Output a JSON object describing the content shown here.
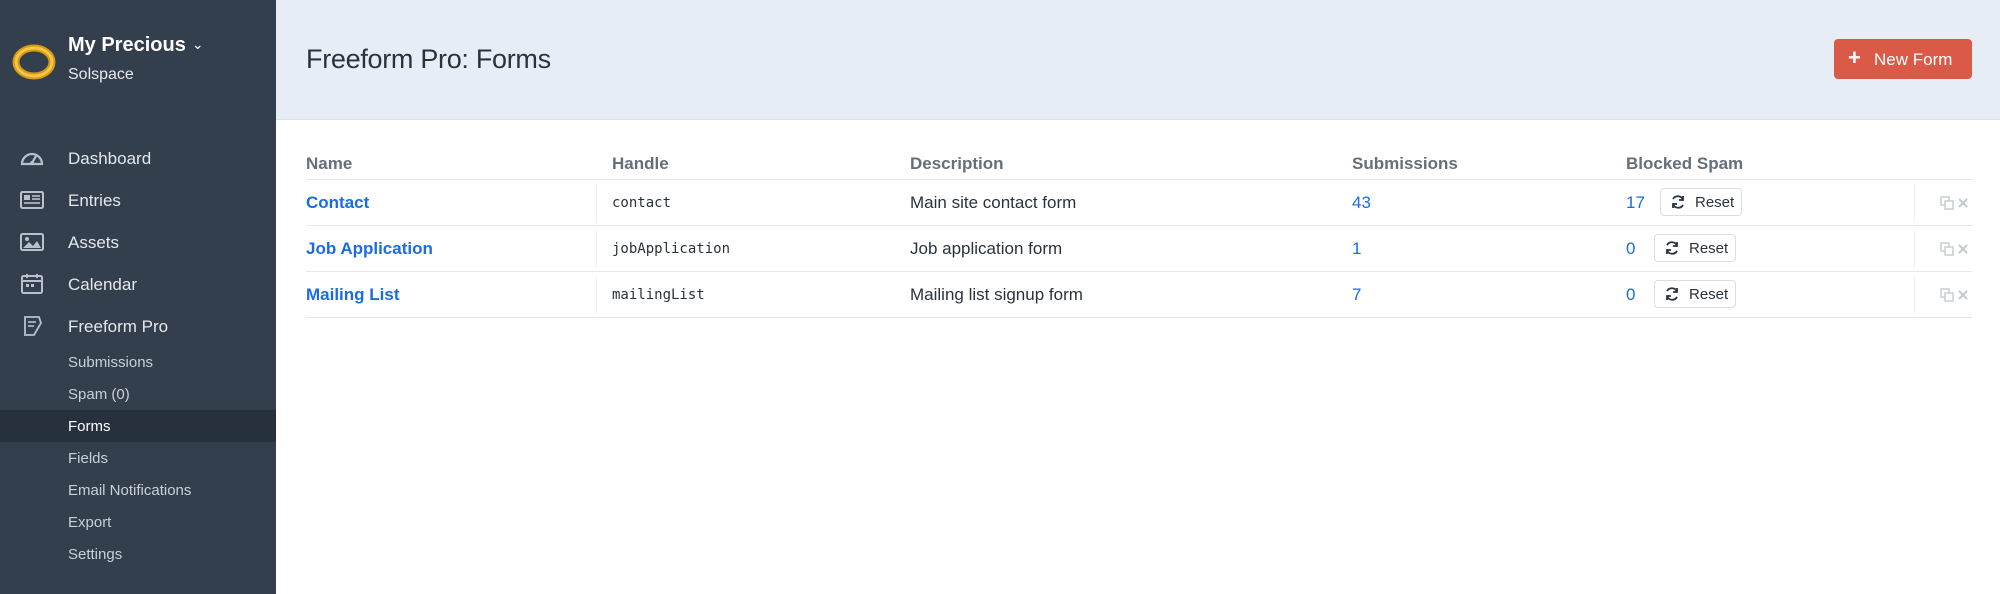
{
  "site": {
    "name": "My Precious",
    "subtitle": "Solspace",
    "chevron": "chevron-down-icon",
    "logo": "ring-logo"
  },
  "nav": [
    {
      "label": "Dashboard",
      "icon": "dashboard-icon"
    },
    {
      "label": "Entries",
      "icon": "entries-icon"
    },
    {
      "label": "Assets",
      "icon": "image-icon"
    },
    {
      "label": "Calendar",
      "icon": "calendar-icon"
    },
    {
      "label": "Freeform Pro",
      "icon": "freeform-icon"
    }
  ],
  "subnav": [
    {
      "label": "Submissions",
      "active": false
    },
    {
      "label": "Spam (0)",
      "active": false
    },
    {
      "label": "Forms",
      "active": true
    },
    {
      "label": "Fields",
      "active": false
    },
    {
      "label": "Email Notifications",
      "active": false
    },
    {
      "label": "Export",
      "active": false
    },
    {
      "label": "Settings",
      "active": false
    }
  ],
  "header": {
    "title": "Freeform Pro: Forms",
    "new_button": "New Form"
  },
  "table": {
    "columns": [
      "Name",
      "Handle",
      "Description",
      "Submissions",
      "Blocked Spam"
    ],
    "reset_label": "Reset",
    "rows": [
      {
        "name": "Contact",
        "handle": "contact",
        "description": "Main site contact form",
        "submissions": "43",
        "spam": "17"
      },
      {
        "name": "Job Application",
        "handle": "jobApplication",
        "description": "Job application form",
        "submissions": "1",
        "spam": "0"
      },
      {
        "name": "Mailing List",
        "handle": "mailingList",
        "description": "Mailing list signup form",
        "submissions": "7",
        "spam": "0"
      }
    ]
  },
  "colors": {
    "sidebar": "#333f4d",
    "accent": "#da5a47",
    "link": "#1b6ce0",
    "header_bg": "#e6edf5"
  }
}
